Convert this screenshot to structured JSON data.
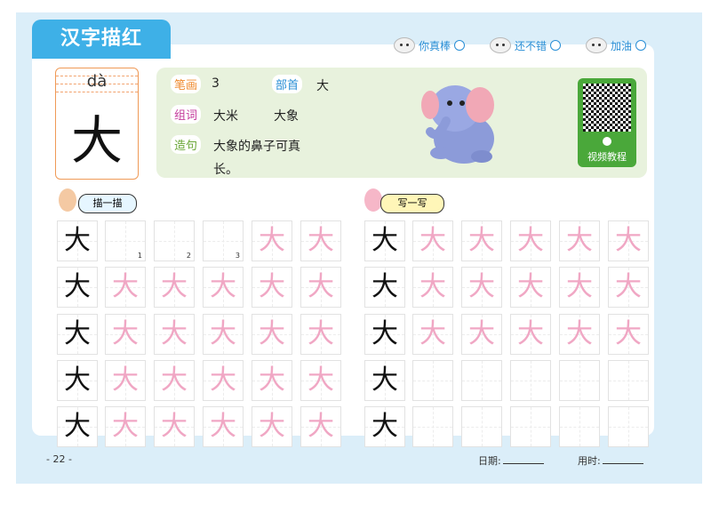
{
  "header": {
    "title": "汉字描红",
    "ratings": [
      {
        "label": "你真棒",
        "icon": "smiley-face-icon"
      },
      {
        "label": "还不错",
        "icon": "smiley-face-icon"
      },
      {
        "label": "加油",
        "icon": "smiley-face-icon"
      }
    ]
  },
  "character": {
    "pinyin": "dà",
    "char": "大"
  },
  "info": {
    "strokes_label": "笔画",
    "strokes_value": "3",
    "radical_label": "部首",
    "radical_value": "大",
    "words_label": "组词",
    "word1": "大米",
    "word2": "大象",
    "sentence_label": "造句",
    "sentence_line1": "大象的鼻子可真",
    "sentence_line2": "长。"
  },
  "qr": {
    "label": "视频教程"
  },
  "sections": {
    "trace": "描一描",
    "write": "写一写"
  },
  "grid": {
    "model_char": "大",
    "stroke_numbers": [
      "1",
      "2",
      "3"
    ]
  },
  "colors": {
    "tab_blue": "#3eb0e7",
    "trace_pink": "#f0a7c4",
    "info_green": "#e8f2dd"
  },
  "footer": {
    "page": "- 22 -",
    "date_label": "日期:",
    "time_label": "用时:"
  }
}
